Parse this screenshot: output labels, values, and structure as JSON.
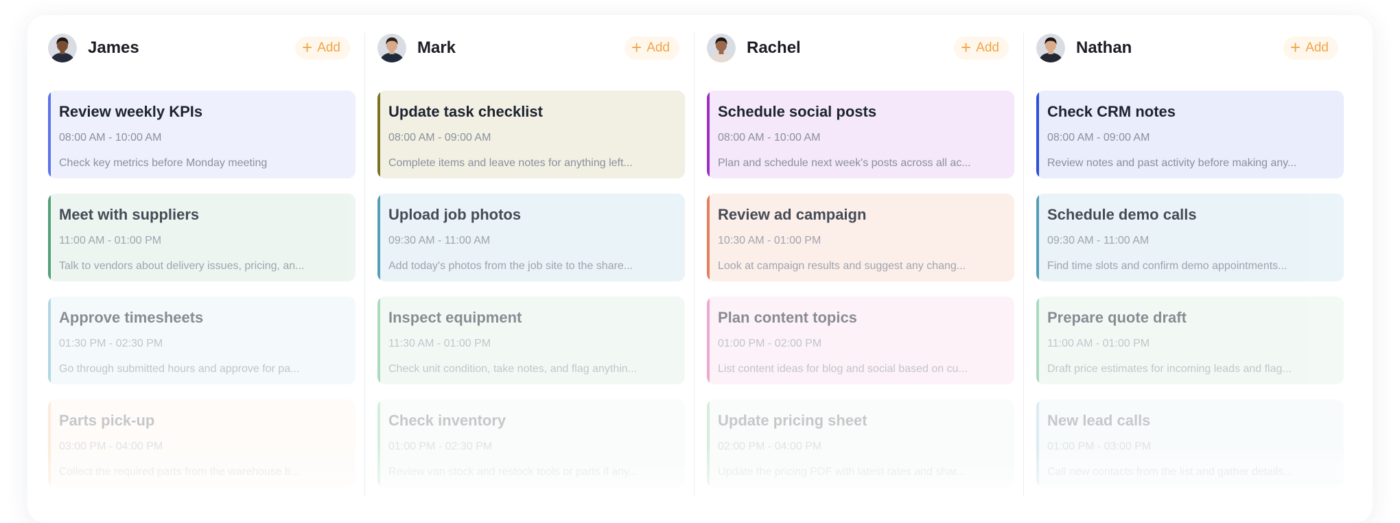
{
  "columns": [
    {
      "name": "James",
      "add_label": "Add",
      "avatar": {
        "icon": "person-avatar",
        "skin": "#7a4e35",
        "hair": "#1c1512",
        "shirt": "#242b3a"
      },
      "tasks": [
        {
          "title": "Review weekly KPIs",
          "time": "08:00 AM - 10:00 AM",
          "desc": "Check key metrics before Monday meeting",
          "accent": "#5b73e8",
          "bg": "#eef1fd"
        },
        {
          "title": "Meet with suppliers",
          "time": "11:00 AM - 01:00 PM",
          "desc": "Talk to vendors about delivery issues, pricing, an...",
          "accent": "#2f8a5a",
          "bg": "#eaf4ee"
        },
        {
          "title": "Approve timesheets",
          "time": "01:30 PM - 02:30 PM",
          "desc": "Go through submitted hours and approve for pa...",
          "accent": "#6fb4c8",
          "bg": "#eaf4f8"
        },
        {
          "title": "Parts pick-up",
          "time": "03:00 PM - 04:00 PM",
          "desc": "Collect the required parts from the warehouse b...",
          "accent": "#f5b26b",
          "bg": "#fdf3e8"
        }
      ]
    },
    {
      "name": "Mark",
      "add_label": "Add",
      "avatar": {
        "icon": "person-avatar",
        "skin": "#d7a98a",
        "hair": "#2b211b",
        "shirt": "#1f2a3a"
      },
      "tasks": [
        {
          "title": "Update task checklist",
          "time": "08:00 AM - 09:00 AM",
          "desc": "Complete items and leave notes for anything left...",
          "accent": "#7a7420",
          "bg": "#f1f0e3"
        },
        {
          "title": "Upload job photos",
          "time": "09:30 AM - 11:00 AM",
          "desc": "Add today's photos from the job site to the share...",
          "accent": "#2f8aa8",
          "bg": "#e6f1f6"
        },
        {
          "title": "Inspect equipment",
          "time": "11:30 AM - 01:00 PM",
          "desc": "Check unit condition, take notes, and flag anythin...",
          "accent": "#5dbb84",
          "bg": "#e8f4ec"
        },
        {
          "title": "Check inventory",
          "time": "01:00 PM - 02:30 PM",
          "desc": "Review van stock and restock tools or parts if any...",
          "accent": "#5dbb84",
          "bg": "#e8f4ec"
        }
      ]
    },
    {
      "name": "Rachel",
      "add_label": "Add",
      "avatar": {
        "icon": "person-avatar",
        "skin": "#9b6a4c",
        "hair": "#1d1410",
        "shirt": "#e5dbd2"
      },
      "tasks": [
        {
          "title": "Schedule social posts",
          "time": "08:00 AM - 10:00 AM",
          "desc": "Plan and schedule next week's posts across all ac...",
          "accent": "#9c2fc2",
          "bg": "#f4e8fa"
        },
        {
          "title": "Review ad campaign",
          "time": "10:30 AM - 01:00 PM",
          "desc": "Look at campaign results and suggest any chang...",
          "accent": "#e0623a",
          "bg": "#fcece6"
        },
        {
          "title": "Plan content topics",
          "time": "01:00 PM - 02:00 PM",
          "desc": "List content ideas for blog and social based on cu...",
          "accent": "#e05aa5",
          "bg": "#fbe7f2"
        },
        {
          "title": "Update pricing sheet",
          "time": "02:00 PM - 04:00 PM",
          "desc": "Update the pricing PDF with latest rates and shar...",
          "accent": "#5dbb84",
          "bg": "#e8f4ec"
        }
      ]
    },
    {
      "name": "Nathan",
      "add_label": "Add",
      "avatar": {
        "icon": "person-avatar",
        "skin": "#d9ab8a",
        "hair": "#1b1512",
        "shirt": "#232733"
      },
      "tasks": [
        {
          "title": "Check CRM notes",
          "time": "08:00 AM - 09:00 AM",
          "desc": "Review notes and past activity before making any...",
          "accent": "#2d4fd6",
          "bg": "#e9edfc"
        },
        {
          "title": "Schedule demo calls",
          "time": "09:30 AM - 11:00 AM",
          "desc": "Find time slots and confirm demo appointments...",
          "accent": "#2f8aa8",
          "bg": "#e6f1f6"
        },
        {
          "title": "Prepare quote draft",
          "time": "11:00 AM - 01:00 PM",
          "desc": "Draft price estimates for incoming leads and flag...",
          "accent": "#5dbb84",
          "bg": "#e8f4ec"
        },
        {
          "title": "New lead calls",
          "time": "01:00 PM - 03:00 PM",
          "desc": "Call new contacts from the list and gather details...",
          "accent": "#6fb4c8",
          "bg": "#e6f1f6"
        }
      ]
    }
  ]
}
